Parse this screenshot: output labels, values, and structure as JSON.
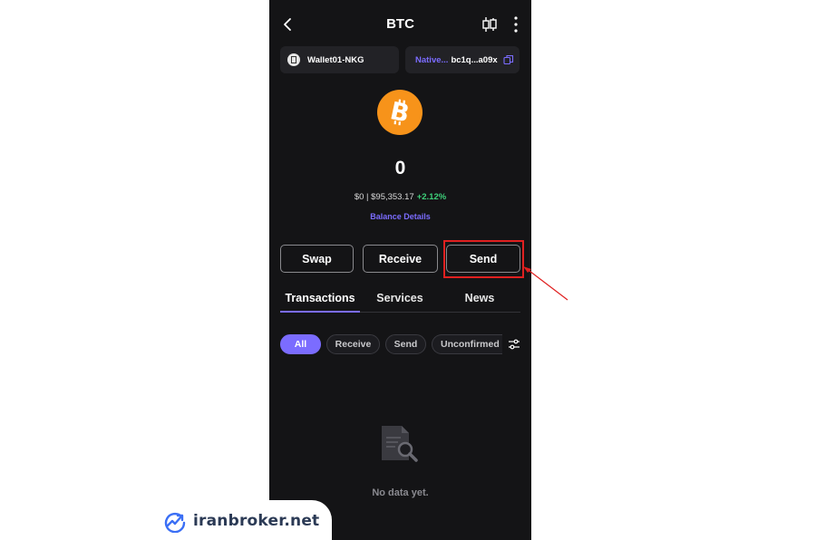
{
  "header": {
    "title": "BTC",
    "back_icon": "chevron-left-icon",
    "chart_icon": "candlestick-icon",
    "more_icon": "more-vertical-icon"
  },
  "wallet": {
    "name": "Wallet01-NKG",
    "address_type": "Native...",
    "address": "bc1q...a09x"
  },
  "asset": {
    "balance": "0",
    "fiat_value": "$0 | $95,353.17",
    "change": "+2.12%",
    "details_link": "Balance Details"
  },
  "actions": {
    "swap": "Swap",
    "receive": "Receive",
    "send": "Send"
  },
  "tabs": [
    {
      "label": "Transactions"
    },
    {
      "label": "Services"
    },
    {
      "label": "News"
    }
  ],
  "filters": [
    {
      "label": "All"
    },
    {
      "label": "Receive"
    },
    {
      "label": "Send"
    },
    {
      "label": "Unconfirmed"
    }
  ],
  "empty_state": {
    "message": "No data yet."
  },
  "watermark": {
    "text": "iranbroker.net"
  },
  "colors": {
    "accent": "#7b6cff",
    "positive": "#3ed07a",
    "bitcoin": "#f7931a",
    "annotation": "#e02020"
  }
}
